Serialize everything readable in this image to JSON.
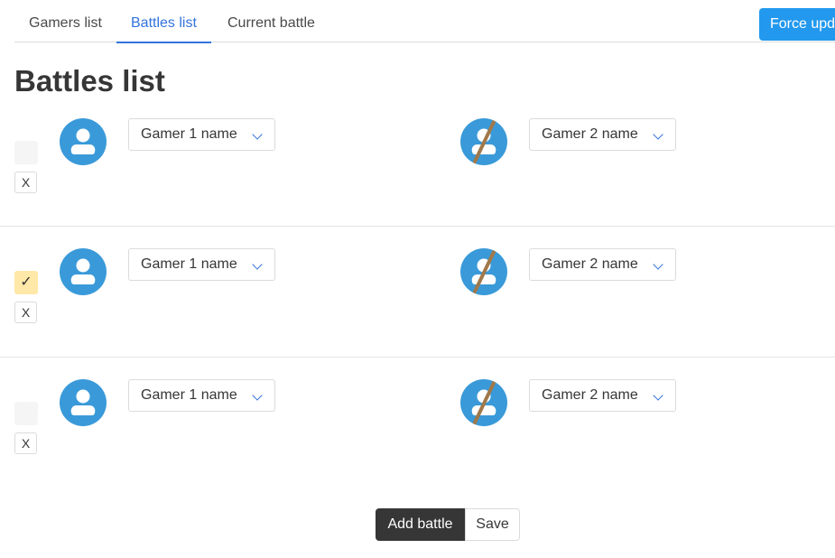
{
  "tabs": [
    {
      "label": "Gamers list",
      "active": false
    },
    {
      "label": "Battles list",
      "active": true
    },
    {
      "label": "Current battle",
      "active": false
    }
  ],
  "header": {
    "force_update_label": "Force upd"
  },
  "page": {
    "title": "Battles list"
  },
  "battles": [
    {
      "checked": false,
      "check_mark": "",
      "delete_label": "X",
      "gamer1_select": "Gamer 1 name",
      "gamer2_select": "Gamer 2 name",
      "gamer1_icon": "user-icon",
      "gamer2_icon": "user-crossed-icon"
    },
    {
      "checked": true,
      "check_mark": "✓",
      "delete_label": "X",
      "gamer1_select": "Gamer 1 name",
      "gamer2_select": "Gamer 2 name",
      "gamer1_icon": "user-icon",
      "gamer2_icon": "user-crossed-icon"
    },
    {
      "checked": false,
      "check_mark": "",
      "delete_label": "X",
      "gamer1_select": "Gamer 1 name",
      "gamer2_select": "Gamer 2 name",
      "gamer1_icon": "user-icon",
      "gamer2_icon": "user-crossed-icon"
    }
  ],
  "footer": {
    "add_battle_label": "Add battle",
    "save_label": "Save"
  },
  "colors": {
    "accent": "#3273dc",
    "avatar": "#3a9ad9",
    "force_button": "#2299ee",
    "checked": "#ffe8a8",
    "strike": "#a0784a"
  }
}
